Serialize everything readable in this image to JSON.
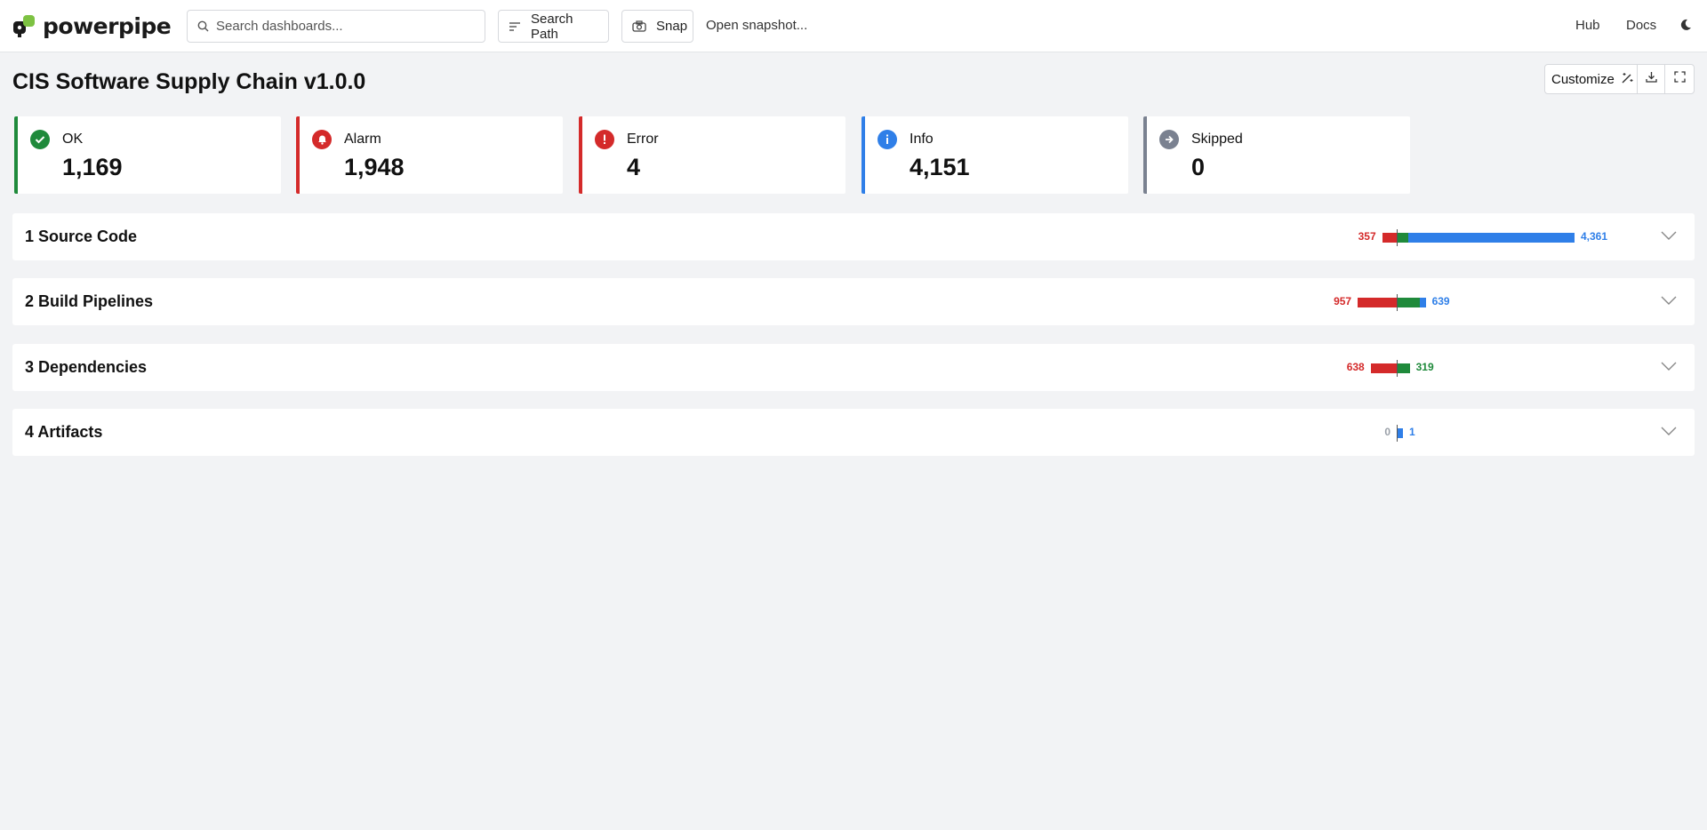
{
  "app": {
    "logo_text": "powerpipe"
  },
  "topbar": {
    "search_placeholder": "Search dashboards...",
    "search_path_label": "Search Path",
    "snap_label": "Snap",
    "open_snapshot_label": "Open snapshot...",
    "hub_label": "Hub",
    "docs_label": "Docs"
  },
  "page": {
    "title": "CIS Software Supply Chain v1.0.0",
    "customize_label": "Customize"
  },
  "summary": [
    {
      "label": "OK",
      "value": "1,169",
      "color": "#1f8a3b",
      "icon": "check-circle-icon"
    },
    {
      "label": "Alarm",
      "value": "1,948",
      "color": "#d42a2a",
      "icon": "bell-icon"
    },
    {
      "label": "Error",
      "value": "4",
      "color": "#d42a2a",
      "icon": "exclamation-icon"
    },
    {
      "label": "Info",
      "value": "4,151",
      "color": "#2f7fe8",
      "icon": "info-icon"
    },
    {
      "label": "Skipped",
      "value": "0",
      "color": "#7a8190",
      "icon": "arrow-right-icon"
    }
  ],
  "sections": [
    {
      "title": "1 Source Code",
      "left_value": "357",
      "right_value": "4,361",
      "left_color": "#d42a2a",
      "right_color": "#2f7fe8",
      "alarm": 357,
      "ok": 292,
      "info": 4069
    },
    {
      "title": "2 Build Pipelines",
      "left_value": "957",
      "right_value": "639",
      "left_color": "#d42a2a",
      "right_color": "#2f7fe8",
      "alarm": 957,
      "ok": 558,
      "info": 81
    },
    {
      "title": "3 Dependencies",
      "left_value": "638",
      "right_value": "319",
      "left_color": "#d42a2a",
      "right_color": "#1f8a3b",
      "alarm": 638,
      "ok": 319,
      "info": 0
    },
    {
      "title": "4 Artifacts",
      "left_value": "0",
      "right_value": "1",
      "left_color": "#9aa0a8",
      "right_color": "#2f7fe8",
      "alarm": 0,
      "ok": 0,
      "info": 1
    }
  ],
  "colors": {
    "ok": "#1f8a3b",
    "alarm": "#d42a2a",
    "info": "#2f7fe8"
  }
}
